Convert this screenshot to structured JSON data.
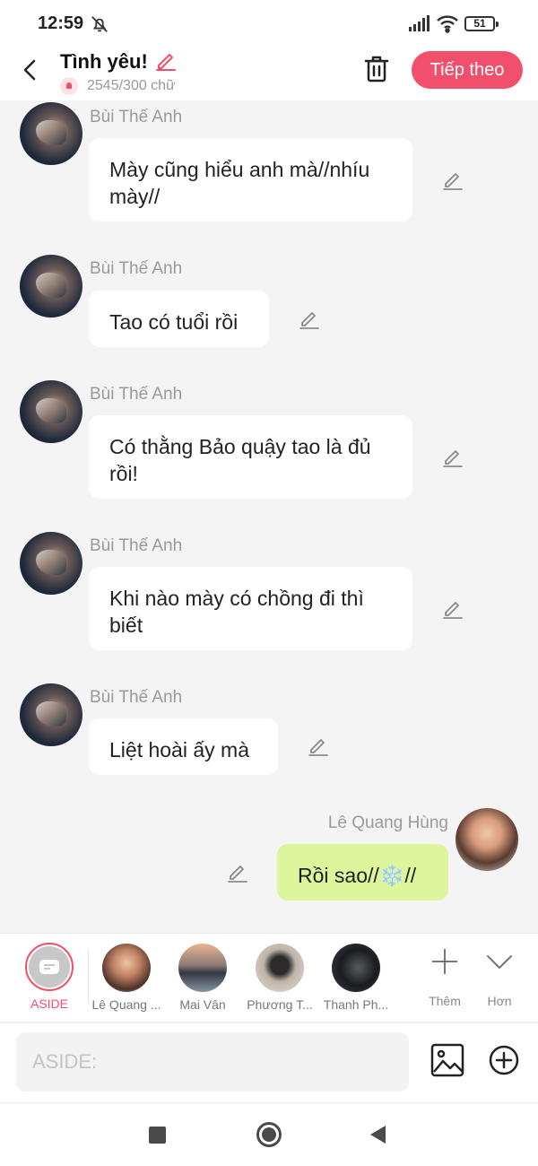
{
  "status_bar": {
    "time": "12:59",
    "battery": "51",
    "icons": [
      "dnd-off-icon",
      "signal-icon",
      "wifi-icon",
      "battery-icon"
    ]
  },
  "header": {
    "title": "Tình yêu!",
    "char_count": "2545/300 chữ",
    "next_label": "Tiếp theo",
    "accent_color": "#f24f6c"
  },
  "messages": [
    {
      "sender": "Bùi Thế Anh",
      "text": "Mày cũng hiểu anh mà//nhíu mày//",
      "side": "left"
    },
    {
      "sender": "Bùi Thế Anh",
      "text": "Tao có tuổi rồi",
      "side": "left"
    },
    {
      "sender": "Bùi Thế Anh",
      "text": "Có thằng Bảo quậy tao là đủ rồi!",
      "side": "left"
    },
    {
      "sender": "Bùi Thế Anh",
      "text": "Khi nào mày có chồng đi thì biết",
      "side": "left"
    },
    {
      "sender": "Bùi Thế Anh",
      "text": "Liệt hoài ấy mà",
      "side": "left"
    },
    {
      "sender": "Lê Quang Hùng",
      "text": "Rồi sao//❄️//",
      "side": "right",
      "bubble_color": "#ddf59b"
    }
  ],
  "characters": [
    {
      "name": "ASIDE",
      "selected": true
    },
    {
      "name": "Lê Quang ..."
    },
    {
      "name": "Mai Vân"
    },
    {
      "name": "Phương T..."
    },
    {
      "name": "Thanh Ph..."
    }
  ],
  "tools": {
    "add_label": "Thêm",
    "more_label": "Hơn"
  },
  "composer": {
    "placeholder": "ASIDE:",
    "value": ""
  }
}
